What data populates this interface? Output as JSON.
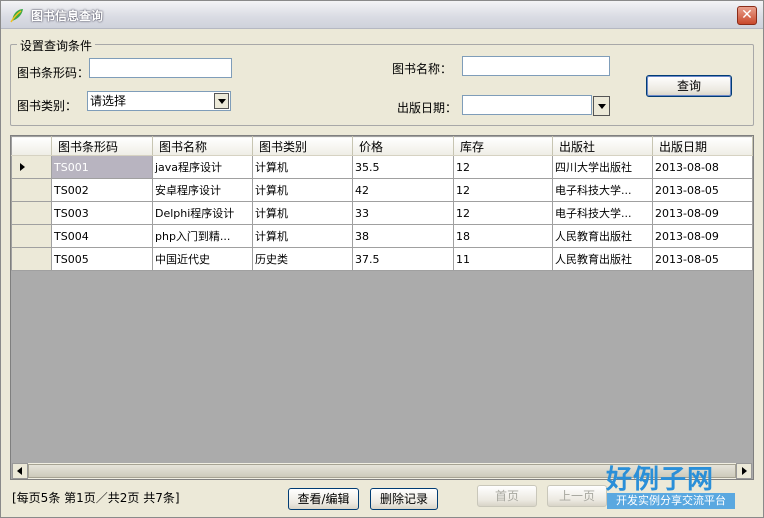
{
  "window": {
    "title": "图书信息查询",
    "close_glyph": "✕"
  },
  "filters": {
    "group_title": "设置查询条件",
    "barcode_label": "图书条形码：",
    "barcode_value": "",
    "name_label": "图书名称：",
    "name_value": "",
    "category_label": "图书类别：",
    "category_value": "请选择",
    "date_label": "出版日期：",
    "date_value": "",
    "query_button": "查询"
  },
  "grid": {
    "columns": [
      "图书条形码",
      "图书名称",
      "图书类别",
      "价格",
      "库存",
      "出版社",
      "出版日期"
    ],
    "rows": [
      [
        "TS001",
        "java程序设计",
        "计算机",
        "35.5",
        "12",
        "四川大学出版社",
        "2013-08-08"
      ],
      [
        "TS002",
        "安卓程序设计",
        "计算机",
        "42",
        "12",
        "电子科技大学...",
        "2013-08-05"
      ],
      [
        "TS003",
        "Delphi程序设计",
        "计算机",
        "33",
        "12",
        "电子科技大学...",
        "2013-08-09"
      ],
      [
        "TS004",
        "php入门到精...",
        "计算机",
        "38",
        "18",
        "人民教育出版社",
        "2013-08-09"
      ],
      [
        "TS005",
        "中国近代史",
        "历史类",
        "37.5",
        "11",
        "人民教育出版社",
        "2013-08-05"
      ]
    ],
    "selected_row": 0
  },
  "footer": {
    "status_text": "[每页5条  第1页／共2页    共7条]",
    "view_edit_button": "查看/编辑",
    "delete_button": "删除记录",
    "first_page_button": "首页",
    "prev_page_button": "上一页"
  },
  "watermark": {
    "logo_text": "好例子网",
    "sub_text": "开发实例分享交流平台"
  },
  "colors": {
    "selected_cell": "#b8b4c0",
    "button_border": "#003c74",
    "window_bg": "#ece9d8"
  },
  "icons": {
    "app": "leaf-icon",
    "close": "close-icon",
    "dropdown": "chevron-down-icon"
  }
}
